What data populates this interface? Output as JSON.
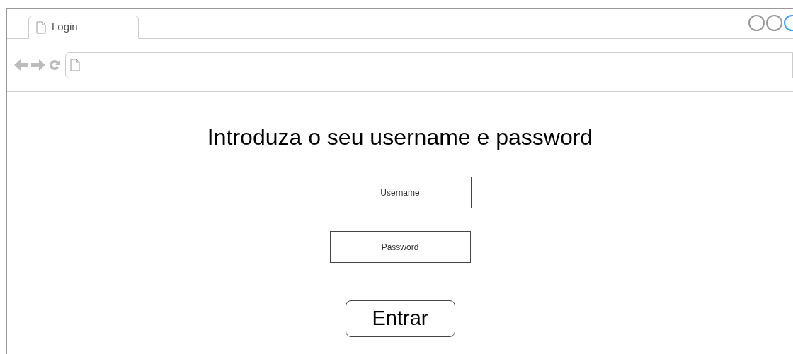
{
  "tabs": [
    {
      "label": "Login",
      "selected": true
    }
  ],
  "heading": "Introduza o seu username e password",
  "fields": [
    {
      "placeholder": "Username",
      "kind": "text"
    },
    {
      "placeholder": "Password",
      "kind": "password"
    }
  ],
  "button": "Entrar"
}
